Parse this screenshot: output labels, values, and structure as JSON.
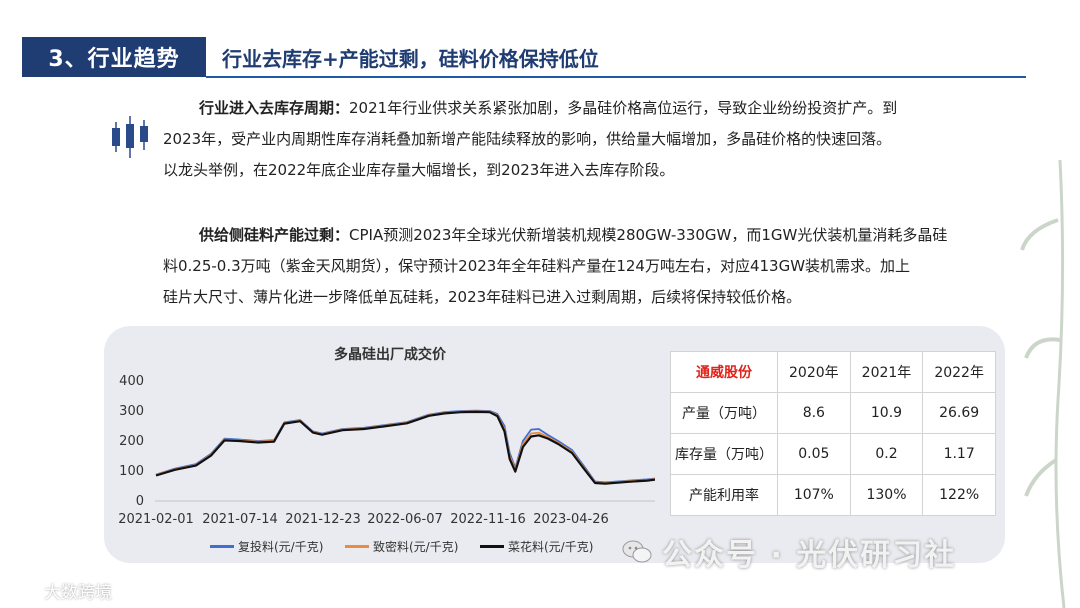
{
  "header": {
    "section_label": "3、行业趋势",
    "title": "行业去库存+产能过剩，硅料价格保持低位"
  },
  "paragraphs": [
    {
      "lead": "行业进入去库存周期：",
      "line1": "2021年行业供求关系紧张加剧，多晶硅价格高位运行，导致企业纷纷投资扩产。到",
      "line2": "2023年，受产业内周期性库存消耗叠加新增产能陆续释放的影响，供给量大幅增加，多晶硅价格的快速回落。",
      "line3": "以龙头举例，在2022年底企业库存量大幅增长，到2023年进入去库存阶段。"
    },
    {
      "lead": "供给侧硅料产能过剩：",
      "line1": "CPIA预测2023年全球光伏新增装机规模280GW-330GW，而1GW光伏装机量消耗多晶硅",
      "line2": "料0.25-0.3万吨（紫金天风期货），保守预计2023年全年硅料产量在124万吨左右，对应413GW装机需求。加上",
      "line3": "硅片大尺寸、薄片化进一步降低单瓦硅耗，2023年硅料已进入过剩周期，后续将保持较低价格。"
    }
  ],
  "chart_data": {
    "type": "line",
    "title": "多晶硅出厂成交价",
    "x_tick_labels": [
      "2021-02-01",
      "2021-07-14",
      "2021-12-23",
      "2022-06-07",
      "2022-11-16",
      "2023-04-26"
    ],
    "y_ticks": [
      0,
      100,
      200,
      300,
      400
    ],
    "ylim": [
      0,
      400
    ],
    "x": [
      "2021-02-01",
      "2021-03-10",
      "2021-04-20",
      "2021-05-20",
      "2021-06-15",
      "2021-07-14",
      "2021-08-20",
      "2021-09-20",
      "2021-10-10",
      "2021-11-10",
      "2021-12-05",
      "2021-12-23",
      "2022-02-01",
      "2022-03-15",
      "2022-04-20",
      "2022-06-07",
      "2022-07-20",
      "2022-08-20",
      "2022-09-20",
      "2022-10-20",
      "2022-11-16",
      "2022-12-01",
      "2022-12-15",
      "2022-12-25",
      "2023-01-05",
      "2023-01-20",
      "2023-02-05",
      "2023-02-20",
      "2023-03-10",
      "2023-03-30",
      "2023-04-26",
      "2023-05-20",
      "2023-06-10",
      "2023-06-30",
      "2023-08-15",
      "2023-09-20",
      "2023-10-20"
    ],
    "series": [
      {
        "name": "复投料(元/千克)",
        "color": "#3f6fd3",
        "values": [
          88,
          108,
          123,
          158,
          208,
          205,
          200,
          203,
          262,
          270,
          232,
          225,
          240,
          244,
          252,
          263,
          288,
          296,
          300,
          301,
          300,
          290,
          250,
          160,
          110,
          200,
          238,
          240,
          220,
          200,
          170,
          115,
          65,
          62,
          68,
          72,
          78
        ]
      },
      {
        "name": "致密料(元/千克)",
        "color": "#ec8a3d",
        "values": [
          87,
          106,
          120,
          155,
          205,
          202,
          198,
          201,
          260,
          268,
          230,
          223,
          238,
          242,
          250,
          261,
          286,
          294,
          298,
          299,
          298,
          286,
          240,
          150,
          104,
          190,
          225,
          228,
          213,
          194,
          164,
          110,
          62,
          60,
          66,
          70,
          76
        ]
      },
      {
        "name": "菜花料(元/千克)",
        "color": "#111111",
        "values": [
          85,
          104,
          118,
          152,
          202,
          200,
          195,
          198,
          258,
          266,
          228,
          221,
          236,
          240,
          248,
          259,
          284,
          292,
          296,
          297,
          296,
          283,
          232,
          140,
          98,
          180,
          215,
          219,
          208,
          190,
          160,
          106,
          60,
          58,
          64,
          68,
          74
        ]
      }
    ]
  },
  "table": {
    "company": "通威股份",
    "years": [
      "2020年",
      "2021年",
      "2022年"
    ],
    "rows": [
      {
        "label": "产量（万吨）",
        "values": [
          "8.6",
          "10.9",
          "26.69"
        ]
      },
      {
        "label": "库存量（万吨）",
        "values": [
          "0.05",
          "0.2",
          "1.17"
        ]
      },
      {
        "label": "产能利用率",
        "values": [
          "107%",
          "130%",
          "122%"
        ]
      }
    ]
  },
  "watermarks": {
    "left": "大数跨境",
    "right": "公众号 · 光伏研习社"
  },
  "icons": {
    "header_candles": "candlestick-icon",
    "wechat": "wechat-icon"
  },
  "colors": {
    "brand_blue": "#1f3c73",
    "accent_red": "#e0231b"
  }
}
